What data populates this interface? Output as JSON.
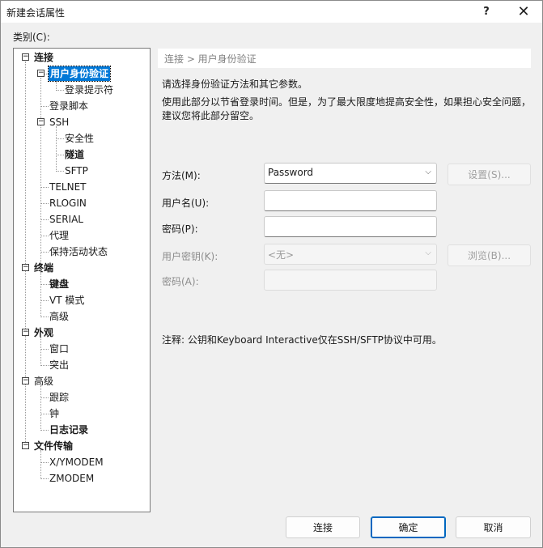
{
  "window": {
    "title": "新建会话属性",
    "help_glyph": "?",
    "close_glyph": "✕"
  },
  "category_label": "类别(C):",
  "tree": {
    "nodes": [
      "连接",
      "用户身份验证",
      "登录提示符",
      "登录脚本",
      "SSH",
      "安全性",
      "隧道",
      "SFTP",
      "TELNET",
      "RLOGIN",
      "SERIAL",
      "代理",
      "保持活动状态",
      "终端",
      "键盘",
      "VT 模式",
      "高级",
      "外观",
      "窗口",
      "突出",
      "高级",
      "跟踪",
      "钟",
      "日志记录",
      "文件传输",
      "X/YMODEM",
      "ZMODEM"
    ]
  },
  "panel": {
    "breadcrumb": "连接 > 用户身份验证",
    "desc1": "请选择身份验证方法和其它参数。",
    "desc2": "使用此部分以节省登录时间。但是，为了最大限度地提高安全性，如果担心安全问题，建议您将此部分留空。",
    "method_label": "方法(M):",
    "method_value": "Password",
    "settings_button": "设置(S)...",
    "username_label": "用户名(U):",
    "username_value": "",
    "password_label": "密码(P):",
    "password_value": "",
    "userkey_label": "用户密钥(K):",
    "userkey_value": "<无>",
    "browse_button": "浏览(B)...",
    "passphrase_label": "密码(A):",
    "passphrase_value": "",
    "note": "注释: 公钥和Keyboard Interactive仅在SSH/SFTP协议中可用。"
  },
  "footer": {
    "connect": "连接",
    "ok": "确定",
    "cancel": "取消"
  }
}
